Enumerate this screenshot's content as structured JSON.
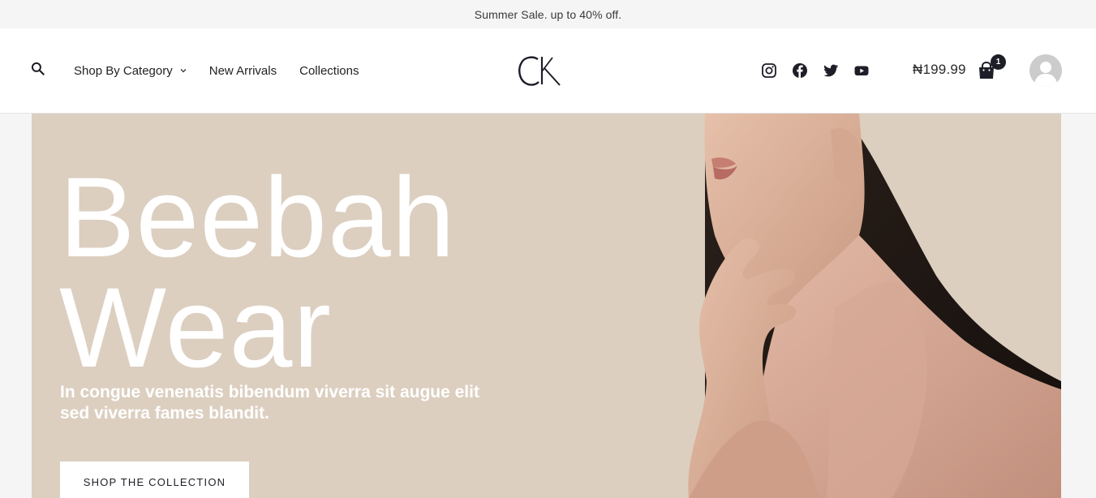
{
  "announcement": "Summer Sale. up to 40% off.",
  "nav": {
    "items": [
      {
        "label": "Shop By Category",
        "has_dropdown": true
      },
      {
        "label": "New Arrivals"
      },
      {
        "label": "Collections"
      }
    ]
  },
  "logo": {
    "text": "CK"
  },
  "socials": [
    "instagram-icon",
    "facebook-icon",
    "twitter-icon",
    "youtube-icon"
  ],
  "cart": {
    "total": "₦199.99",
    "count": "1"
  },
  "hero": {
    "title_line1": "Beebah",
    "title_line2": "Wear",
    "subtitle": "In congue venenatis bibendum viverra sit augue elit sed viverra fames blandit.",
    "button_label": "SHOP THE COLLECTION"
  },
  "colors": {
    "accent": "#1e1e28",
    "hero_bg": "#dccfc0",
    "topbar_bg": "#f5f5f5"
  }
}
